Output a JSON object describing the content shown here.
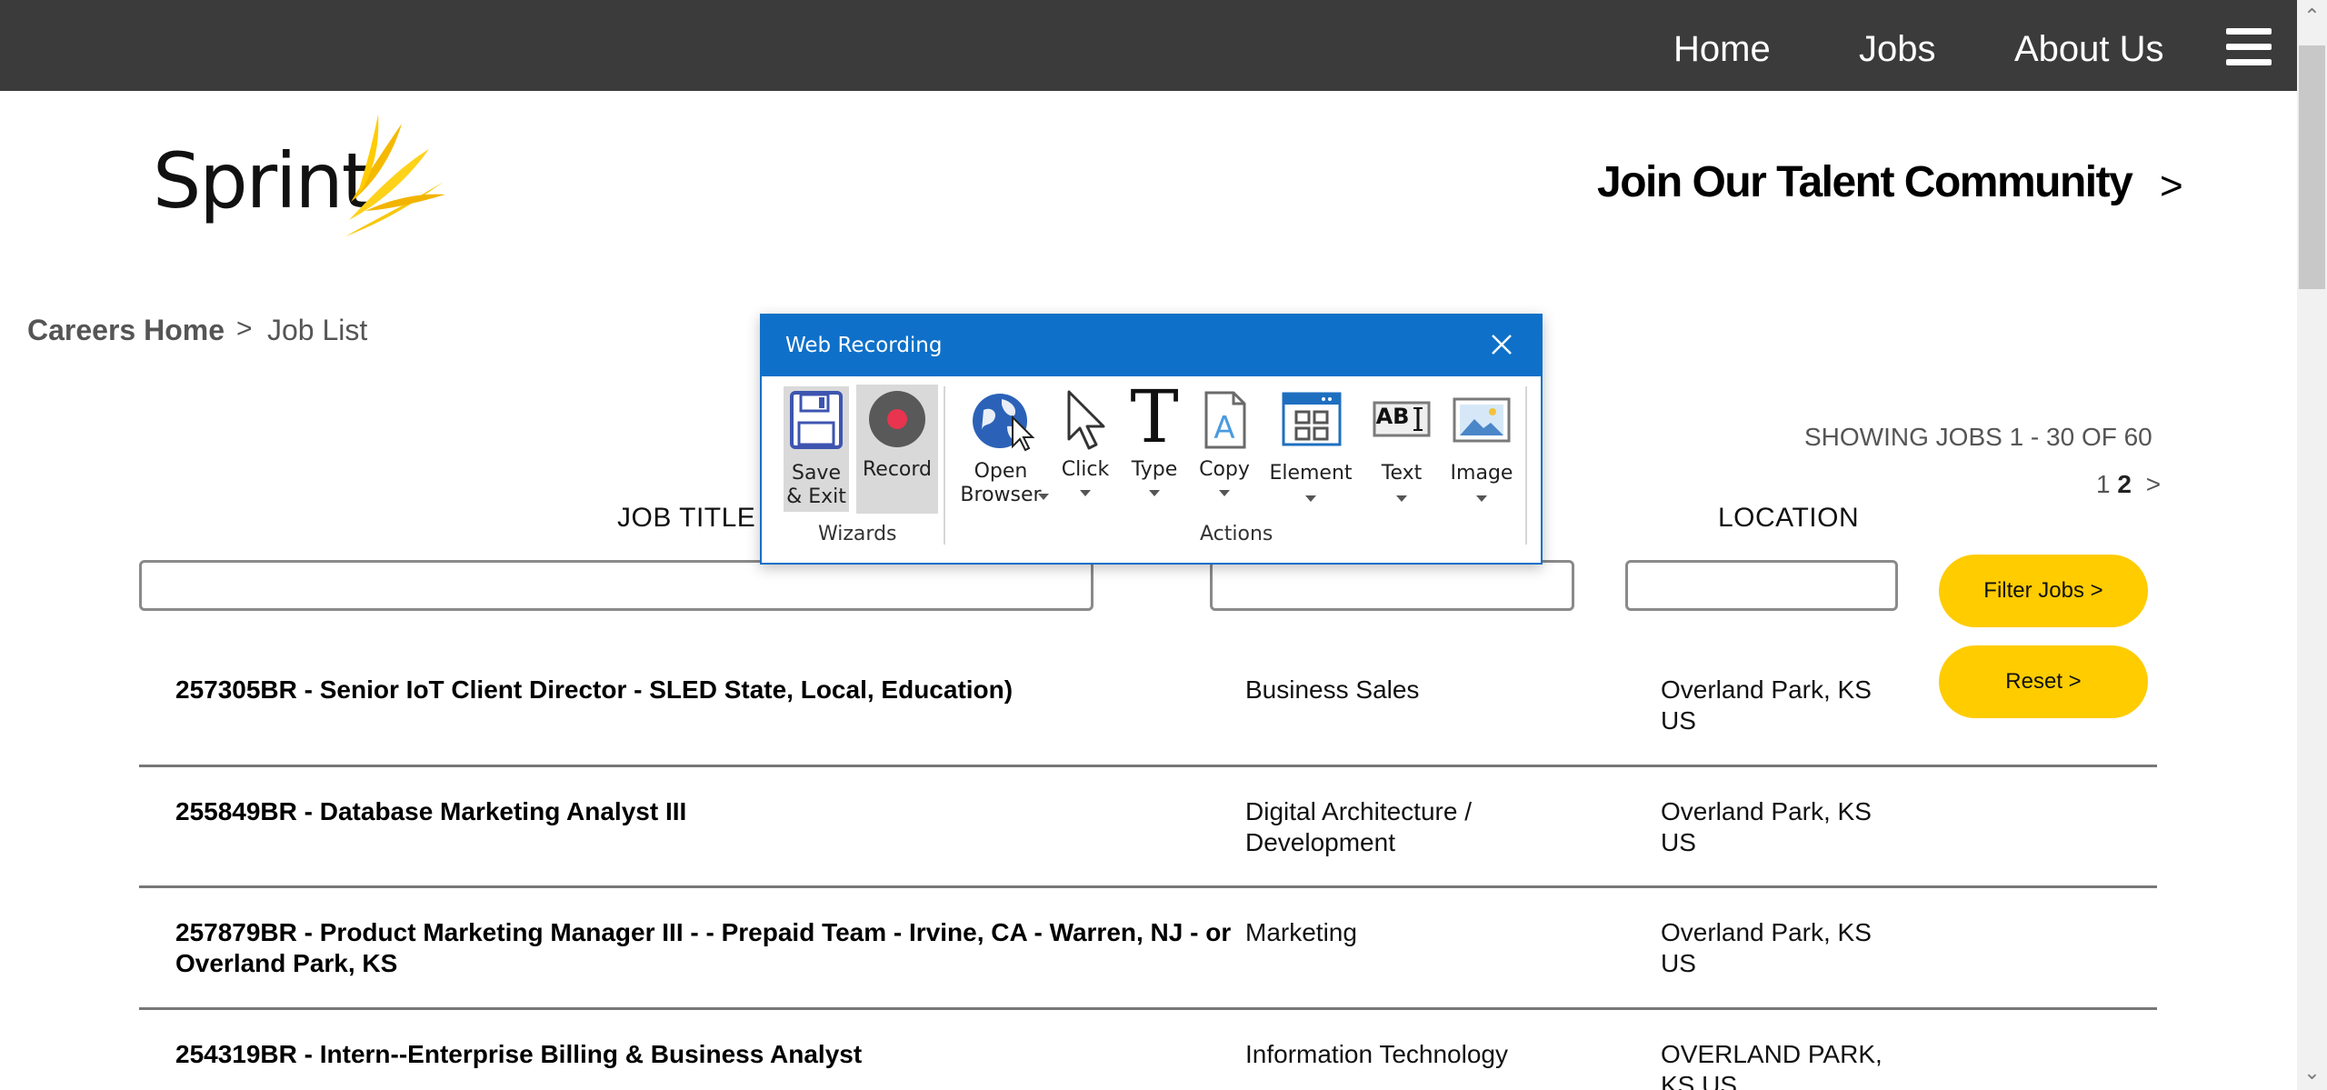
{
  "nav": {
    "links": [
      "Home",
      "Jobs",
      "About Us"
    ]
  },
  "logo": {
    "text": "Sprint"
  },
  "join": {
    "label": "Join Our Talent Community",
    "chevron": ">"
  },
  "breadcrumb": {
    "home": "Careers Home",
    "separator": ">",
    "current": "Job List"
  },
  "results": {
    "showing": "SHOWING JOBS 1 - 30 OF 60",
    "pages": [
      "1",
      "2"
    ],
    "current_page": "2",
    "next": ">"
  },
  "filters": {
    "job_title_header": "JOB TITLE",
    "location_header": "LOCATION",
    "job_title_value": "",
    "category_value": "",
    "location_value": "",
    "filter_button": "Filter Jobs >",
    "reset_button": "Reset >"
  },
  "jobs": [
    {
      "title": "257305BR - Senior IoT Client Director - SLED State, Local, Education)",
      "category": "Business Sales",
      "location_line1": "Overland Park, KS",
      "location_line2": "US"
    },
    {
      "title": "255849BR - Database Marketing Analyst III",
      "category": "Digital Architecture / Development",
      "location_line1": "Overland Park, KS",
      "location_line2": "US"
    },
    {
      "title": "257879BR - Product Marketing Manager III - - Prepaid Team - Irvine, CA - Warren, NJ - or Overland Park, KS",
      "category": "Marketing",
      "location_line1": "Overland Park, KS",
      "location_line2": "US"
    },
    {
      "title": "254319BR - Intern--Enterprise Billing & Business Analyst",
      "category": "Information Technology",
      "location_line1": "OVERLAND PARK,",
      "location_line2": "KS US"
    }
  ],
  "dialog": {
    "title": "Web Recording",
    "groups": {
      "wizards": "Wizards",
      "actions": "Actions"
    },
    "tools": {
      "save_exit_line1": "Save",
      "save_exit_line2": "& Exit",
      "record": "Record",
      "open_browser_line1": "Open",
      "open_browser_line2": "Browser",
      "click": "Click",
      "type": "Type",
      "copy": "Copy",
      "element": "Element",
      "text": "Text",
      "image": "Image"
    },
    "icons": {
      "text_icon_label": "AB",
      "type_icon_label": "T",
      "copy_icon_label": "A"
    }
  },
  "colors": {
    "nav_bg": "#3b3b3b",
    "accent_yellow": "#ffcc00",
    "dialog_blue": "#0f70c9",
    "record_red": "#e8344e"
  }
}
